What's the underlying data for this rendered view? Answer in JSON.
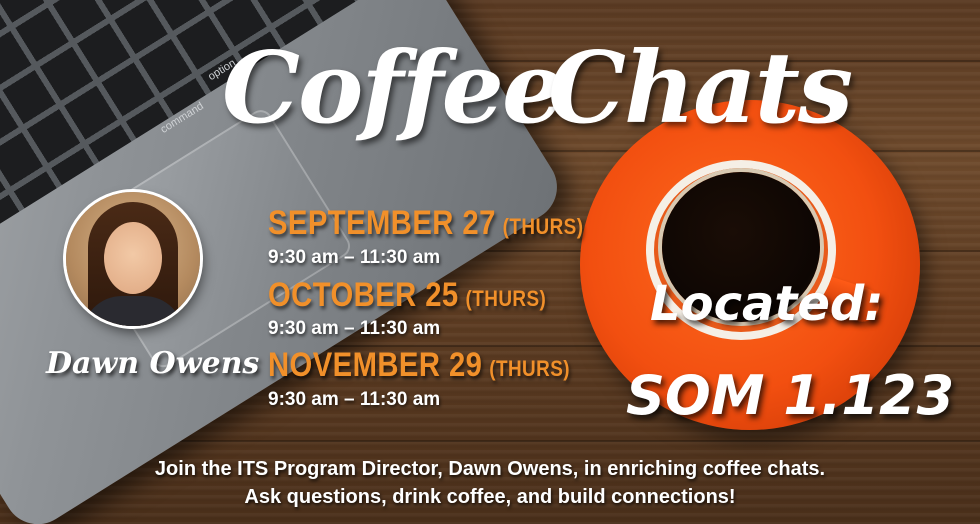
{
  "title": {
    "word1": "Coffee",
    "word2": "Chats"
  },
  "host": {
    "name": "Dawn Owens"
  },
  "laptop_keys": {
    "command": "command",
    "option": "option"
  },
  "sessions": [
    {
      "date": "SEPTEMBER 27",
      "day": "(THURS)",
      "time": "9:30 am – 11:30 am"
    },
    {
      "date": "OCTOBER 25",
      "day": "(THURS)",
      "time": "9:30 am – 11:30 am"
    },
    {
      "date": "NOVEMBER 29",
      "day": "(THURS)",
      "time": "9:30 am – 11:30 am"
    }
  ],
  "location": {
    "label": "Located:",
    "room": "SOM 1.123"
  },
  "footer": {
    "line1": "Join the ITS Program Director, Dawn Owens, in enriching coffee chats.",
    "line2": "Ask questions, drink coffee, and build connections!"
  },
  "colors": {
    "accent": "#f1902a",
    "saucer": "#f24f10",
    "text": "#ffffff"
  }
}
